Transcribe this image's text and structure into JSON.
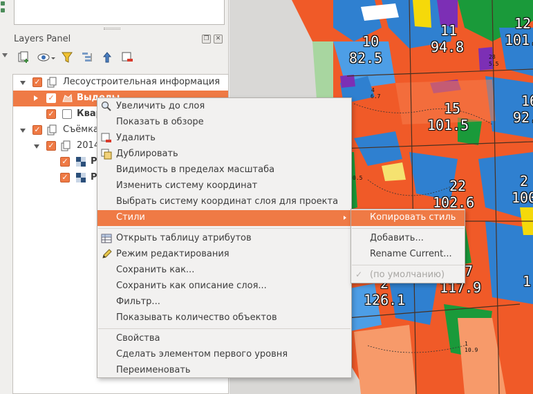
{
  "layers_panel": {
    "title": "Layers Panel",
    "float_btn": "❐",
    "close_btn": "✕",
    "tree": [
      {
        "label": "Лесоустроительная информация",
        "checked": true
      },
      {
        "label": "Выделы",
        "checked": true
      },
      {
        "label": "Квар",
        "checked": false
      },
      {
        "label": "Съёмка",
        "checked": true
      },
      {
        "label": "2014",
        "checked": true
      },
      {
        "label": "P",
        "checked": true
      },
      {
        "label": "P",
        "checked": true
      }
    ]
  },
  "map": {
    "labels": [
      {
        "id": "l10",
        "num": "10",
        "val": "82.5"
      },
      {
        "id": "l11",
        "num": "11",
        "val": "94.8"
      },
      {
        "id": "l12",
        "num": "12",
        "val": "101."
      },
      {
        "id": "l15",
        "num": "15",
        "val": "101.5"
      },
      {
        "id": "l16",
        "num": "16",
        "val": "92."
      },
      {
        "id": "l22",
        "num": "22",
        "val": "102.6"
      },
      {
        "id": "l2x",
        "num": "2",
        "val": "100"
      },
      {
        "id": "l27",
        "num": "7",
        "val": "117.9"
      },
      {
        "id": "l126",
        "num": "2",
        "val": "126.1"
      },
      {
        "id": "lr",
        "num": "",
        "val": "1"
      }
    ],
    "small_labels": [
      "28",
      "5.5",
      "4",
      "6.7",
      "0.5",
      "1",
      "10.9"
    ]
  },
  "context_menu": {
    "items": [
      {
        "label": "Увеличить до слоя",
        "icon": "zoom-icon"
      },
      {
        "label": "Показать в обзоре"
      },
      {
        "label": "Удалить",
        "icon": "remove-layer-icon"
      },
      {
        "label": "Дублировать",
        "icon": "duplicate-icon"
      },
      {
        "label": "Видимость в пределах масштаба"
      },
      {
        "label": "Изменить систему координат"
      },
      {
        "label": "Выбрать систему координат слоя для проекта"
      },
      {
        "label": "Стили",
        "submenu": true
      },
      {
        "label": "Открыть таблицу атрибутов",
        "icon": "table-icon"
      },
      {
        "label": "Режим редактирования",
        "icon": "pencil-icon"
      },
      {
        "label": "Сохранить как..."
      },
      {
        "label": "Сохранить как описание слоя..."
      },
      {
        "label": "Фильтр..."
      },
      {
        "label": "Показывать количество объектов"
      },
      {
        "label": "Свойства"
      },
      {
        "label": "Сделать элементом первого уровня"
      },
      {
        "label": "Переименовать"
      }
    ]
  },
  "styles_submenu": {
    "items": [
      {
        "label": "Копировать стиль"
      },
      {
        "label": "Добавить..."
      },
      {
        "label": "Rename Current..."
      },
      {
        "label": "(по умолчанию)",
        "checked": true
      }
    ]
  },
  "colors": {
    "accent": "#ef7a45",
    "menu_bg": "#f2f1f0"
  }
}
